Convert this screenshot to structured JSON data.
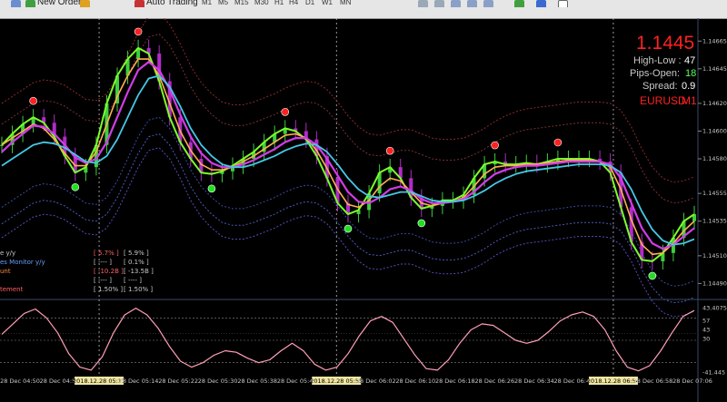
{
  "toolbar": {
    "new_order_label": "New Order",
    "auto_trading_label": "Auto Trading",
    "timeframes": [
      "M1",
      "M5",
      "M15",
      "M30",
      "H1",
      "H4",
      "D1",
      "W1",
      "MN"
    ]
  },
  "info_panel": {
    "price": "1.1445",
    "high_low_label": "High-Low :",
    "high_low_value": "47",
    "pips_open_label": "Pips-Open:",
    "pips_open_value": "18",
    "spread_label": "Spread:",
    "spread_value": "0.9",
    "symbol": "EURUSD",
    "timeframe": "M1"
  },
  "legend": [
    {
      "name": "e y/y",
      "value1": "[ 5.7% ]",
      "value2": "[ 5.9% ]",
      "name_color": "#c8c8c8",
      "value1_color": "#ff6060"
    },
    {
      "name": "es Monitor y/y",
      "value1": "[ ---- ]",
      "value2": "[ 0.1% ]",
      "name_color": "#6a9fff",
      "value1_color": "#c8c8c8"
    },
    {
      "name": "unt",
      "value1": "[ -10.2B ]",
      "value2": "[ -13.5B ]",
      "name_color": "#ff8c3c",
      "value1_color": "#ff6060"
    },
    {
      "name": "",
      "value1": "[ ---- ]",
      "value2": "[ ---- ]",
      "name_color": "#c8c8c8",
      "value1_color": "#c8c8c8"
    },
    {
      "name": "tement",
      "value1": "[ 1.50% ]",
      "value2": "[ 1.50% ]",
      "name_color": "#ff6060",
      "value1_color": "#c8c8c8"
    }
  ],
  "colors": {
    "background": "#000000",
    "candle_bull": "#3ecf3e",
    "candle_bear": "#b02cc8",
    "ma_fast": "#7cff2a",
    "ma_mid": "#ffb050",
    "ma_slow_magenta": "#d23ce6",
    "ma_slow_cyan": "#46c8e6",
    "oscillator": "#ffa0b4",
    "price_label": "#ff2020",
    "symbol_label": "#ff2020",
    "axis_text": "#c8c8c8"
  },
  "chart_data": {
    "type": "line",
    "symbol": "EURUSD",
    "timeframe": "M1",
    "price_axis": {
      "ticks": [
        "1.14665",
        "1.14645",
        "1.14620",
        "1.14600",
        "1.14580",
        "1.14555",
        "1.14535",
        "1.14510",
        "1.14490"
      ],
      "tick_values": [
        1.14665,
        1.14645,
        1.1462,
        1.146,
        1.1458,
        1.14555,
        1.14535,
        1.1451,
        1.1449
      ],
      "range": [
        1.14485,
        1.14675
      ]
    },
    "oscillator_axis": {
      "ticks": [
        "43.4075",
        "57",
        "43",
        "30",
        "-41.445"
      ]
    },
    "time_axis": [
      "28 Dec 04:50",
      "28 Dec 04:58",
      "2018.12.28 05:11",
      "28 Dec 05:14",
      "28 Dec 05:22",
      "28 Dec 05:30",
      "28 Dec 05:38",
      "28 Dec 05:46",
      "2018.12.28 05:55",
      "28 Dec 06:02",
      "28 Dec 06:10",
      "28 Dec 06:18",
      "28 Dec 06:26",
      "28 Dec 06:34",
      "28 Dec 06:42",
      "2018.12.28 06:54",
      "28 Dec 06:58",
      "28 Dec 07:06"
    ],
    "highlighted_times": [
      "2018.12.28 05:11",
      "2018.12.28 05:55",
      "2018.12.28 06:54"
    ],
    "series": [
      {
        "name": "",
        "values": [
          1.1459,
          1.14598,
          1.14605,
          1.1461,
          1.14606,
          1.14596,
          1.14582,
          1.1457,
          1.14574,
          1.1459,
          1.1462,
          1.1464,
          1.14652,
          1.1466,
          1.14656,
          1.14636,
          1.1461,
          1.14592,
          1.1458,
          1.1457,
          1.14569,
          1.14571,
          1.14575,
          1.1458,
          1.14585,
          1.14592,
          1.14598,
          1.14602,
          1.146,
          1.14594,
          1.14582,
          1.14566,
          1.14548,
          1.1454,
          1.14543,
          1.14555,
          1.1457,
          1.14574,
          1.14566,
          1.14552,
          1.14544,
          1.14546,
          1.1455,
          1.1455,
          1.14554,
          1.14566,
          1.14576,
          1.14578,
          1.14576,
          1.14576,
          1.14577,
          1.14576,
          1.14578,
          1.1458,
          1.1458,
          1.1458,
          1.1458,
          1.14578,
          1.1457,
          1.14545,
          1.1452,
          1.14507,
          1.14506,
          1.14512,
          1.14523,
          1.14535,
          1.1454
        ]
      },
      {
        "name": "",
        "values": [
          1.1459,
          1.14595,
          1.146,
          1.14605,
          1.14602,
          1.14594,
          1.14584,
          1.14575,
          1.14575,
          1.14585,
          1.14605,
          1.14625,
          1.1464,
          1.14652,
          1.14652,
          1.1464,
          1.1462,
          1.146,
          1.14586,
          1.14576,
          1.14572,
          1.14572,
          1.14574,
          1.14578,
          1.14582,
          1.14587,
          1.14592,
          1.14597,
          1.14598,
          1.14595,
          1.14586,
          1.14573,
          1.14558,
          1.14547,
          1.14545,
          1.1455,
          1.1456,
          1.14566,
          1.14564,
          1.14556,
          1.14548,
          1.14546,
          1.14548,
          1.14549,
          1.14552,
          1.1456,
          1.14569,
          1.14574,
          1.14575,
          1.14575,
          1.14576,
          1.14576,
          1.14577,
          1.14578,
          1.14579,
          1.14579,
          1.14579,
          1.14578,
          1.14574,
          1.14558,
          1.14536,
          1.14518,
          1.14511,
          1.14512,
          1.14519,
          1.14528,
          1.14535
        ]
      },
      {
        "name": "",
        "values": [
          1.14585,
          1.14592,
          1.14598,
          1.14604,
          1.14603,
          1.14598,
          1.1459,
          1.14581,
          1.14577,
          1.1458,
          1.14592,
          1.1461,
          1.14628,
          1.14644,
          1.1465,
          1.14644,
          1.1463,
          1.14612,
          1.14596,
          1.14584,
          1.14577,
          1.14574,
          1.14574,
          1.14576,
          1.14579,
          1.14583,
          1.14587,
          1.14592,
          1.14595,
          1.14595,
          1.1459,
          1.1458,
          1.14568,
          1.14556,
          1.14549,
          1.14548,
          1.14552,
          1.14558,
          1.1456,
          1.14557,
          1.14551,
          1.14548,
          1.14548,
          1.14549,
          1.14551,
          1.14556,
          1.14563,
          1.14569,
          1.14572,
          1.14574,
          1.14575,
          1.14575,
          1.14576,
          1.14577,
          1.14578,
          1.14578,
          1.14578,
          1.14578,
          1.14576,
          1.14566,
          1.14548,
          1.1453,
          1.14519,
          1.14515,
          1.14518,
          1.14524,
          1.1453
        ]
      },
      {
        "name": "",
        "values": [
          1.14575,
          1.1458,
          1.14585,
          1.1459,
          1.14592,
          1.14591,
          1.14588,
          1.14583,
          1.14578,
          1.14577,
          1.14582,
          1.14594,
          1.1461,
          1.14626,
          1.14638,
          1.1464,
          1.14632,
          1.14618,
          1.14602,
          1.1459,
          1.14582,
          1.14576,
          1.14574,
          1.14574,
          1.14576,
          1.14579,
          1.14582,
          1.14586,
          1.14589,
          1.14591,
          1.1459,
          1.14585,
          1.14576,
          1.14566,
          1.14558,
          1.14553,
          1.14552,
          1.14554,
          1.14556,
          1.14556,
          1.14553,
          1.1455,
          1.14549,
          1.14549,
          1.1455,
          1.14553,
          1.14557,
          1.14562,
          1.14566,
          1.14569,
          1.14571,
          1.14572,
          1.14573,
          1.14574,
          1.14575,
          1.14576,
          1.14576,
          1.14576,
          1.14575,
          1.1457,
          1.14558,
          1.14542,
          1.14529,
          1.14521,
          1.14518,
          1.14519,
          1.14522
        ]
      }
    ],
    "oscillator_values": [
      8,
      22,
      36,
      42,
      30,
      10,
      -18,
      -36,
      -40,
      -22,
      10,
      34,
      43,
      34,
      16,
      -8,
      -28,
      -36,
      -30,
      -20,
      -14,
      -16,
      -24,
      -30,
      -26,
      -14,
      -4,
      -14,
      -32,
      -40,
      -36,
      -18,
      6,
      26,
      32,
      24,
      2,
      -20,
      -38,
      -40,
      -26,
      -4,
      14,
      22,
      20,
      10,
      0,
      -4,
      0,
      12,
      26,
      34,
      38,
      32,
      14,
      -14,
      -36,
      -41,
      -34,
      -14,
      10,
      32,
      40
    ]
  }
}
